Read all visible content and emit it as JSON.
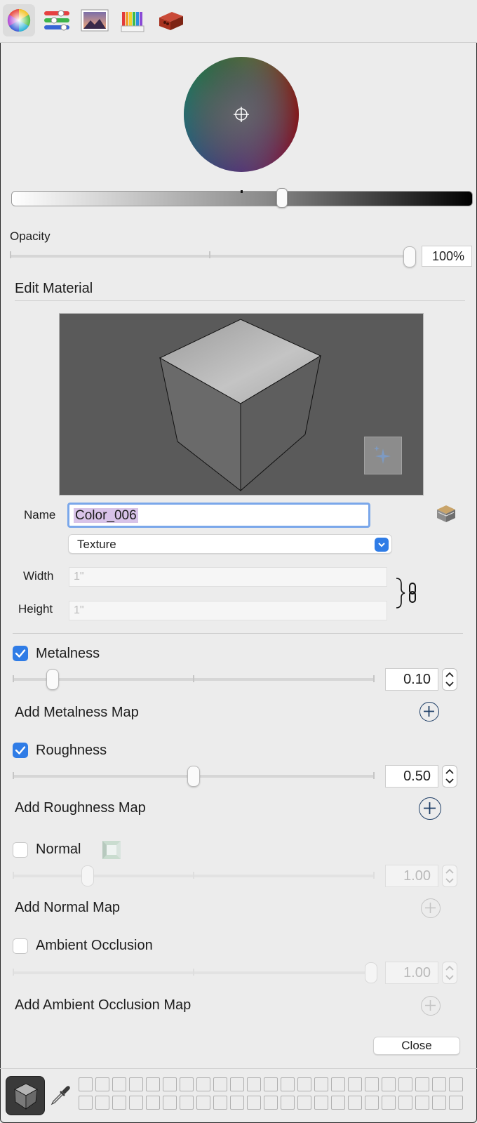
{
  "toolbar": {
    "tabs": [
      {
        "name": "color-wheel-icon",
        "active": true
      },
      {
        "name": "color-sliders-icon",
        "active": false
      },
      {
        "name": "image-palette-icon",
        "active": false
      },
      {
        "name": "pencils-icon",
        "active": false
      },
      {
        "name": "brick-material-icon",
        "active": false
      }
    ]
  },
  "opacity": {
    "label": "Opacity",
    "value": "100%",
    "level": 1.0
  },
  "edit_material": {
    "heading": "Edit Material",
    "name_label": "Name",
    "name_value": "Color_006",
    "texture_select": "Texture",
    "width_label": "Width",
    "width_placeholder": "1\"",
    "height_label": "Height",
    "height_placeholder": "1\""
  },
  "metalness": {
    "label": "Metalness",
    "checked": true,
    "value": "0.10",
    "add_map": "Add Metalness Map"
  },
  "roughness": {
    "label": "Roughness",
    "checked": true,
    "value": "0.50",
    "add_map": "Add Roughness Map"
  },
  "normal": {
    "label": "Normal",
    "checked": false,
    "value": "1.00",
    "add_map": "Add Normal Map"
  },
  "ambient_occlusion": {
    "label": "Ambient Occlusion",
    "checked": false,
    "value": "1.00",
    "add_map": "Add Ambient Occlusion Map"
  },
  "close_button": "Close",
  "colors": {
    "accent": "#2f7ce6",
    "preview_bg": "#5a5a5a",
    "plus_icon": "#1e3e66"
  }
}
